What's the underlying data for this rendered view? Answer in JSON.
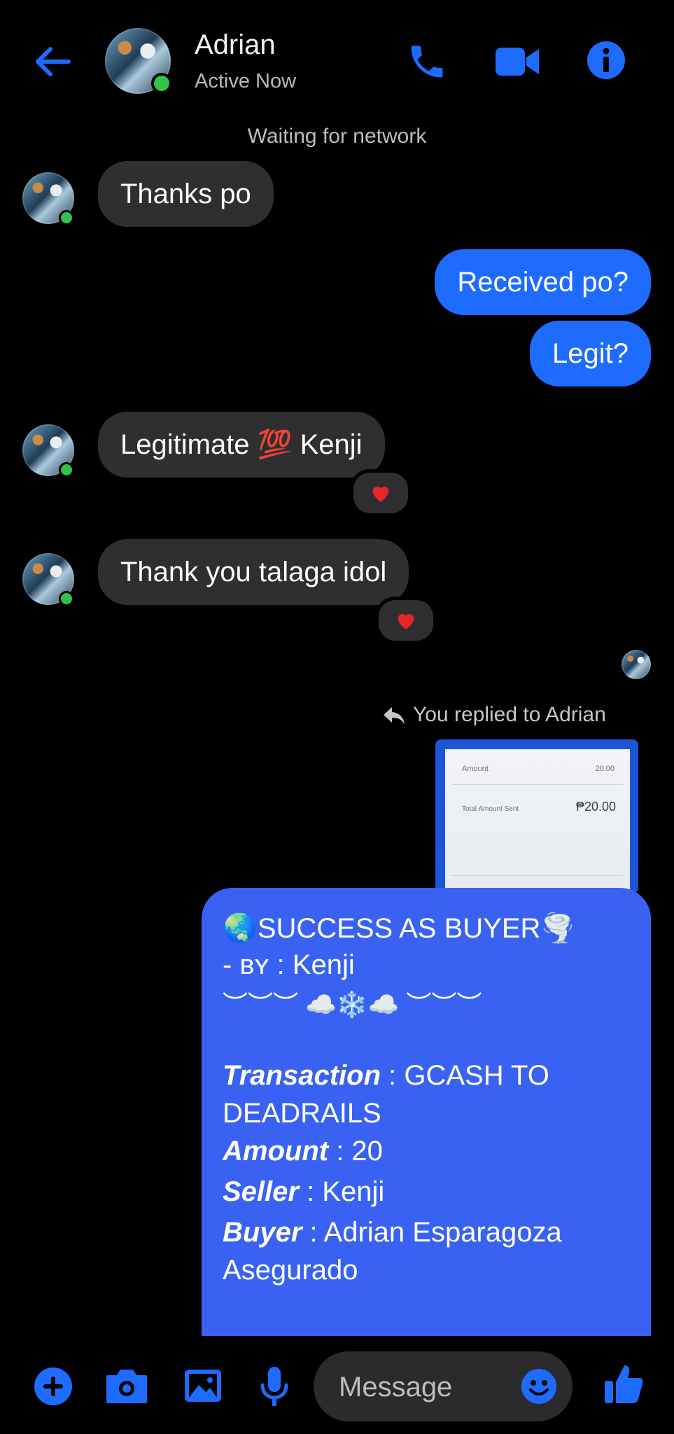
{
  "header": {
    "contact_name": "Adrian",
    "status": "Active Now",
    "accent": "#1e6bff"
  },
  "system_notice": "Waiting for network",
  "messages": [
    {
      "from": "contact",
      "text": "Thanks po"
    },
    {
      "from": "me",
      "text": "Received po?"
    },
    {
      "from": "me",
      "text": "Legit?"
    },
    {
      "from": "contact",
      "text": "Legitimate",
      "emoji": "💯",
      "suffix": "Kenji",
      "reaction": "heart"
    },
    {
      "from": "contact",
      "text": "Thank you talaga idol",
      "reaction": "heart"
    }
  ],
  "reply_note": "You replied to Adrian",
  "receipt_preview": {
    "row1_label": "Amount",
    "row1_value": "20.00",
    "row2_label": "Total Amount Sent",
    "row2_value": "₱20.00"
  },
  "proof_message": {
    "title": "SUCCESS AS BUYER",
    "by_label": "- ʙʏ : ",
    "by_value": "Kenji",
    "decoration": "︶︶︶ ☁️❄️☁️ ︶︶︶",
    "fields": [
      {
        "label": "Transaction",
        "value": " : GCASH TO"
      },
      {
        "label": "",
        "value": "DEADRAILS"
      },
      {
        "label": "Amount",
        "value": " : 20"
      },
      {
        "label": "Seller",
        "value": " : Kenji"
      },
      {
        "label": "Buyer",
        "value": " : Adrian Esparagoza"
      },
      {
        "label": "",
        "value": "Asegurado"
      }
    ]
  },
  "composer": {
    "placeholder": "Message"
  }
}
